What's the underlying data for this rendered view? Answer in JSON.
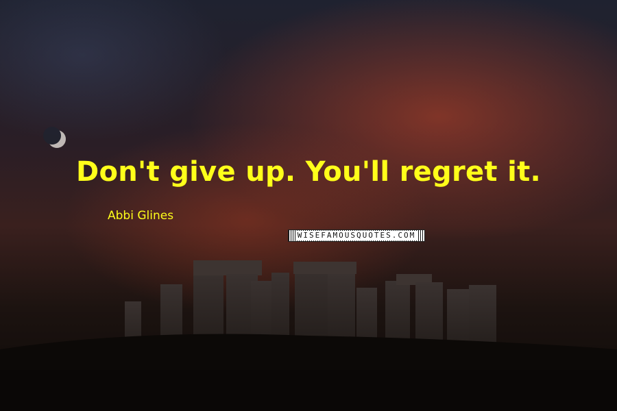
{
  "quote": {
    "text": "Don't give up. You'll regret it.",
    "author": "Abbi Glines",
    "color": "#ffff1a"
  },
  "brand": {
    "logo_text": "WISEFAMOUSQUOTES.COM"
  }
}
